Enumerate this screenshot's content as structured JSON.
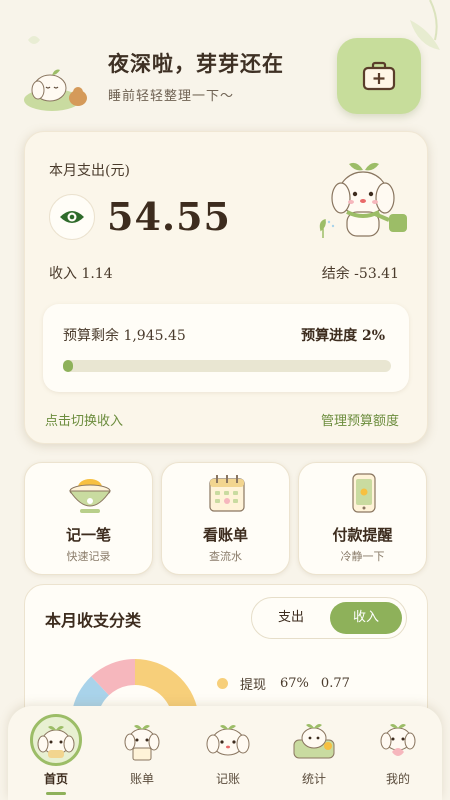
{
  "header": {
    "title": "夜深啦，芽芽还在",
    "subtitle": "睡前轻轻整理一下～",
    "kit_icon": "first-aid-kit-icon"
  },
  "summary": {
    "label": "本月支出(元)",
    "amount": "54.55",
    "income": "收入  1.14",
    "balance": "结余  -53.41",
    "budget_remaining": "预算剩余  1,945.45",
    "budget_progress": "预算进度  2%",
    "budget_progress_value": 0.02,
    "toggle_link": "点击切换收入",
    "manage_link": "管理预算额度"
  },
  "actions": [
    {
      "title": "记一笔",
      "sub": "快速记录",
      "icon": "rice-bowl-icon"
    },
    {
      "title": "看账单",
      "sub": "查流水",
      "icon": "calendar-icon"
    },
    {
      "title": "付款提醒",
      "sub": "冷静一下",
      "icon": "phone-icon"
    }
  ],
  "category": {
    "title": "本月收支分类",
    "tab_expense": "支出",
    "tab_income": "收入",
    "active_tab": "收入",
    "legend": [
      {
        "name": "提现",
        "pct": "67%",
        "value": "0.77",
        "color": "#f7cf7a"
      }
    ]
  },
  "chart_data": {
    "type": "pie",
    "slices": [
      {
        "label": "提现",
        "value": 67,
        "color": "#f7cf7a"
      },
      {
        "label": "",
        "value": 21,
        "color": "#a9d3ea"
      },
      {
        "label": "",
        "value": 12,
        "color": "#f6b7bd"
      }
    ]
  },
  "nav": [
    {
      "label": "首页",
      "active": true
    },
    {
      "label": "账单",
      "active": false
    },
    {
      "label": "记账",
      "active": false
    },
    {
      "label": "统计",
      "active": false
    },
    {
      "label": "我的",
      "active": false
    }
  ],
  "colors": {
    "accent_green": "#8eb15a",
    "kit_button": "#c7dd9b",
    "background": "#f8f4ea"
  }
}
